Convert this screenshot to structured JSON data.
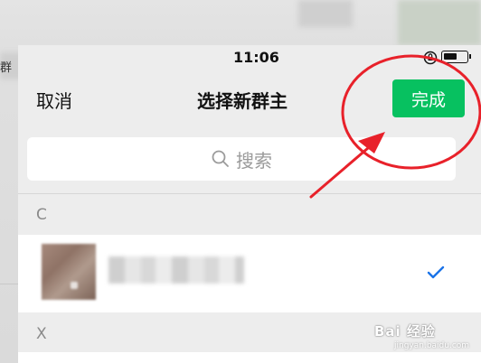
{
  "background": {
    "left_text": "群"
  },
  "status_bar": {
    "time": "11:06"
  },
  "nav": {
    "cancel_label": "取消",
    "title": "选择新群主",
    "done_label": "完成"
  },
  "search": {
    "placeholder": "搜索"
  },
  "sections": [
    {
      "letter": "C"
    },
    {
      "letter": "X"
    }
  ],
  "watermark": {
    "text": "Bai 经验",
    "sub": "jingyan.baidu.com"
  },
  "colors": {
    "accent_green": "#07c160",
    "check_blue": "#1a73e8",
    "annotation_red": "#e8212a"
  }
}
